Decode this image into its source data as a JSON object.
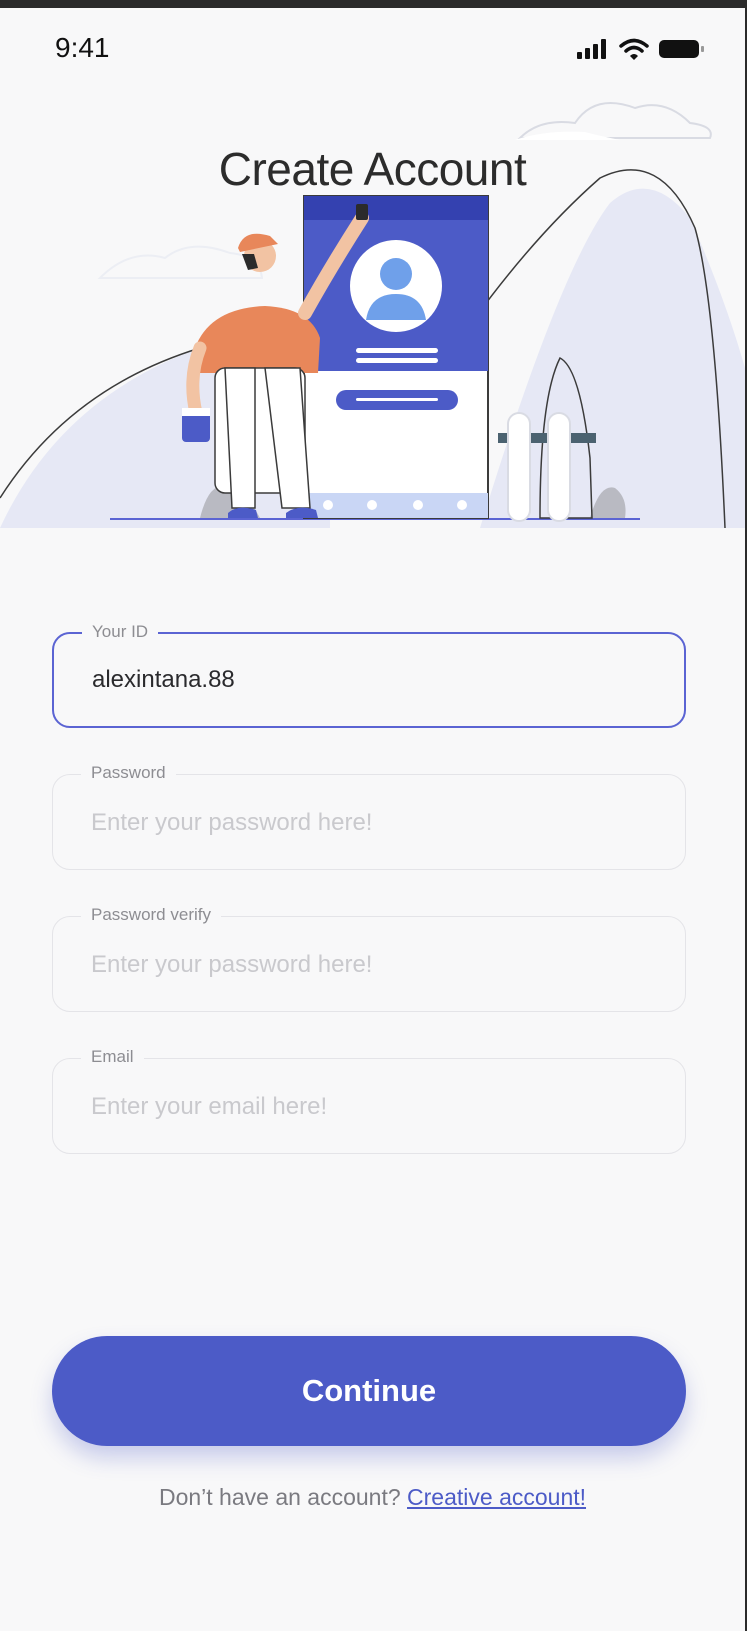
{
  "status_bar": {
    "time": "9:41",
    "signal_icon": "signal-icon",
    "wifi_icon": "wifi-icon",
    "battery_icon": "battery-icon"
  },
  "header": {
    "title": "Create Account"
  },
  "form": {
    "fields": [
      {
        "label": "Your ID",
        "value": "alexintana.88",
        "placeholder": ""
      },
      {
        "label": "Password",
        "value": "",
        "placeholder": "Enter your password here!"
      },
      {
        "label": "Password verify",
        "value": "",
        "placeholder": "Enter your password here!"
      },
      {
        "label": "Email",
        "value": "",
        "placeholder": "Enter your email here!"
      }
    ]
  },
  "actions": {
    "continue_label": "Continue"
  },
  "footer": {
    "prompt": "Don’t have an account?",
    "link_label": "Creative account!"
  },
  "colors": {
    "accent": "#4c5bc7",
    "active_border": "#5b64d3",
    "background": "#f8f8f9"
  }
}
